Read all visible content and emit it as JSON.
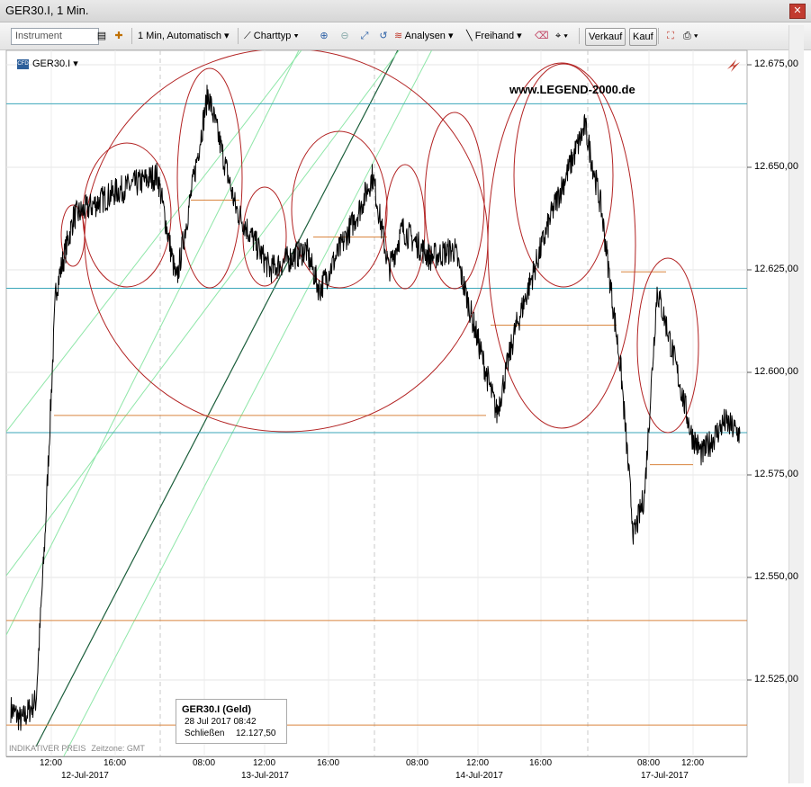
{
  "window": {
    "title": "GER30.I, 1 Min."
  },
  "toolbar": {
    "instrument_placeholder": "Instrument",
    "interval_label": "1 Min, Automatisch",
    "charttype_label": "Charttyp",
    "analysen_label": "Analysen",
    "freihand_label": "Freihand",
    "verkauf_label": "Verkauf",
    "kauf_label": "Kauf"
  },
  "chart": {
    "symbol": "GER30.I",
    "cfd_badge": "CFD",
    "watermark": "www.LEGEND-2000.de",
    "info_box": {
      "title": "GER30.I (Geld)",
      "date": "28 Jul 2017 08:42",
      "close_label": "Schließen",
      "close_value": "12.127,50"
    },
    "footer_left": "INDIKATIVER PREIS",
    "footer_tz": "Zeitzone: GMT",
    "y_labels": [
      "12.675,00",
      "12.650,00",
      "12.625,00",
      "12.600,00",
      "12.575,00",
      "12.550,00",
      "12.525,00"
    ],
    "x_hours": [
      "12:00",
      "16:00",
      "08:00",
      "12:00",
      "16:00",
      "08:00",
      "12:00",
      "16:00",
      "08:00",
      "12:00"
    ],
    "x_days": [
      "12-Jul-2017",
      "13-Jul-2017",
      "14-Jul-2017",
      "17-Jul-2017"
    ],
    "accent_colors": {
      "price": "#000000",
      "hline_blue": "#3aa6b9",
      "orange": "#d9853f",
      "ellipse": "#b22222",
      "diag_dark": "#1b5e3b",
      "diag_light": "#8ee6a8"
    }
  },
  "chart_data": {
    "type": "line",
    "title": "GER30.I, 1 Min.",
    "ylim": [
      12505,
      12682
    ],
    "x": [
      "12-Jul 10:00",
      "12-Jul 11:00",
      "12-Jul 12:00",
      "12-Jul 12:30",
      "12-Jul 13:00",
      "12-Jul 14:00",
      "12-Jul 16:00",
      "12-Jul 18:00",
      "13-Jul 07:00",
      "13-Jul 08:00",
      "13-Jul 09:00",
      "13-Jul 10:00",
      "13-Jul 12:00",
      "13-Jul 13:00",
      "13-Jul 15:00",
      "13-Jul 17:00",
      "14-Jul 07:00",
      "14-Jul 08:00",
      "14-Jul 10:00",
      "14-Jul 11:00",
      "14-Jul 12:00",
      "14-Jul 13:00",
      "14-Jul 14:00",
      "14-Jul 16:00",
      "14-Jul 18:00",
      "14-Jul 19:30",
      "14-Jul 21:00",
      "17-Jul 06:00",
      "17-Jul 07:00",
      "17-Jul 08:00",
      "17-Jul 09:00",
      "17-Jul 11:00",
      "17-Jul 12:00",
      "17-Jul 14:00",
      "17-Jul 16:00"
    ],
    "series": [
      {
        "values": [
          12518,
          12515,
          12520,
          12560,
          12620,
          12638,
          12644,
          12648,
          12622,
          12668,
          12640,
          12625,
          12630,
          12620,
          12640,
          12648,
          12625,
          12635,
          12628,
          12630,
          12600,
          12590,
          12610,
          12640,
          12660,
          12640,
          12600,
          12560,
          12570,
          12620,
          12610,
          12585,
          12580,
          12588,
          12585
        ]
      }
    ],
    "horizontal_levels": [
      12665.5,
      12620.5,
      12585.3,
      12589.5,
      12539.5,
      12514
    ],
    "grid": true
  }
}
